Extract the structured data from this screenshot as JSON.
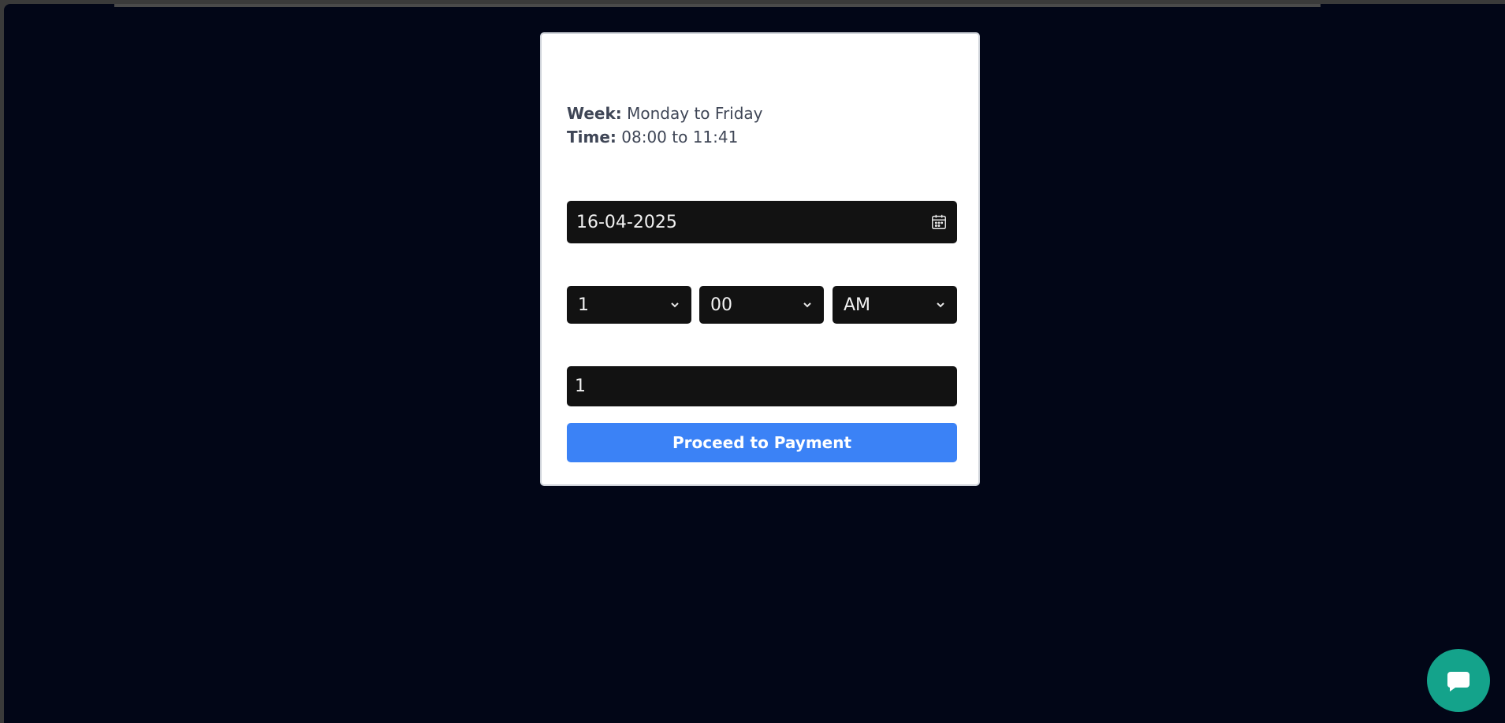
{
  "schedule": {
    "week_label": "Week:",
    "week_value": "Monday to Friday",
    "time_label": "Time:",
    "time_value": "08:00 to 11:41"
  },
  "date_input": {
    "value": "16-04-2025",
    "icon": "calendar-icon"
  },
  "time_selects": {
    "hour": "1",
    "minute": "00",
    "period": "AM"
  },
  "quantity_input": {
    "value": "1"
  },
  "actions": {
    "proceed_label": "Proceed to Payment"
  },
  "chat": {
    "icon": "chat-bubble-icon"
  },
  "colors": {
    "page_background": "#020617",
    "card_background": "#ffffff",
    "field_background": "#121212",
    "primary_button": "#3b82f6",
    "chat_button": "#14a38b"
  }
}
